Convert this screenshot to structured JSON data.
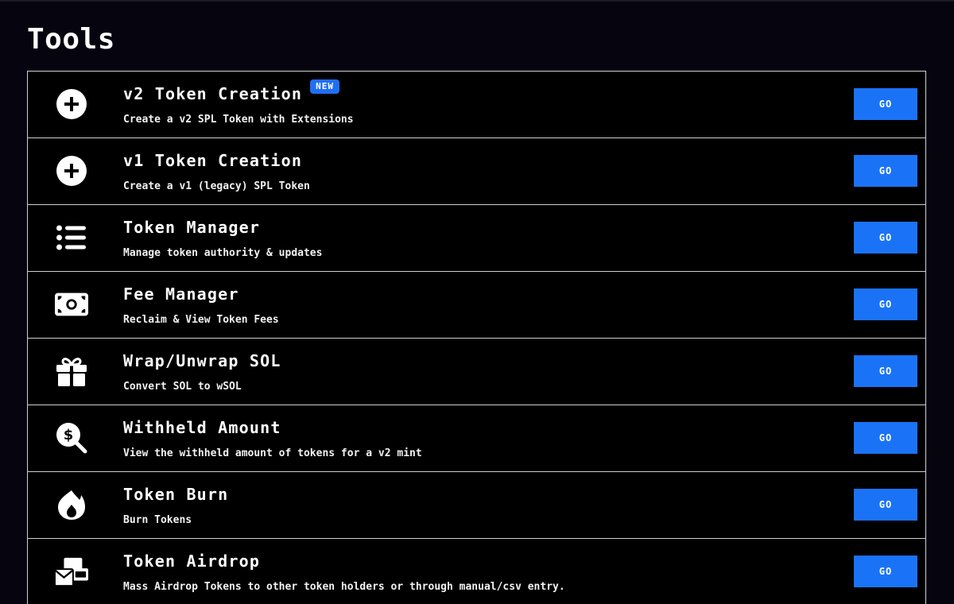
{
  "page": {
    "title": "Tools"
  },
  "theme": {
    "background": "#06040f",
    "panel": "#000000",
    "border": "#cfcfd6",
    "accent": "#1a73f7"
  },
  "tools": [
    {
      "title": "v2 Token Creation",
      "badge": "NEW",
      "description": "Create a v2 SPL Token with Extensions",
      "button": "GO",
      "icon": "plus-circle-icon"
    },
    {
      "title": "v1 Token Creation",
      "description": "Create a v1 (legacy) SPL Token",
      "button": "GO",
      "icon": "plus-circle-icon"
    },
    {
      "title": "Token Manager",
      "description": "Manage token authority & updates",
      "button": "GO",
      "icon": "list-icon"
    },
    {
      "title": "Fee Manager",
      "description": "Reclaim & View Token Fees",
      "button": "GO",
      "icon": "money-bill-icon"
    },
    {
      "title": "Wrap/Unwrap SOL",
      "description": "Convert SOL to wSOL",
      "button": "GO",
      "icon": "gift-icon"
    },
    {
      "title": "Withheld Amount",
      "description": "View the withheld amount of tokens for a v2 mint",
      "button": "GO",
      "icon": "search-dollar-icon"
    },
    {
      "title": "Token Burn",
      "description": "Burn Tokens",
      "button": "GO",
      "icon": "fire-icon"
    },
    {
      "title": "Token Airdrop",
      "description": "Mass Airdrop Tokens to other token holders or through manual/csv entry.",
      "button": "GO",
      "icon": "envelopes-icon"
    }
  ]
}
